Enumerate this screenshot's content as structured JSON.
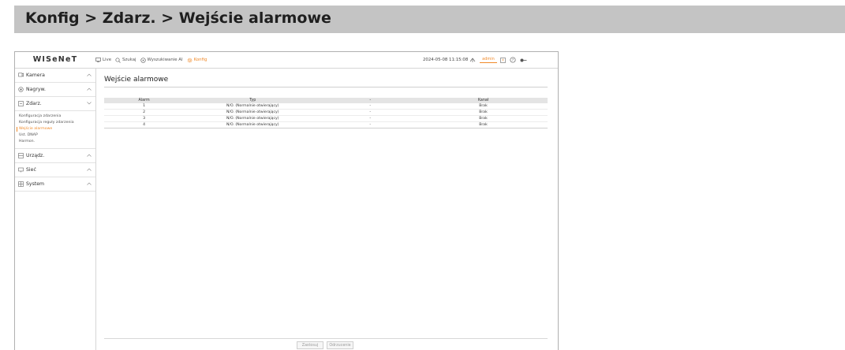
{
  "banner": {
    "title": "Konfig > Zdarz. > Wejście alarmowe"
  },
  "topbar": {
    "logo": "WISeNeT",
    "nav": [
      {
        "label": "Live",
        "icon": "monitor-icon"
      },
      {
        "label": "Szukaj",
        "icon": "search-icon"
      },
      {
        "label": "Wyszukiwanie AI",
        "icon": "ai-search-icon"
      },
      {
        "label": "Konfig",
        "icon": "gear-icon",
        "active": true
      }
    ],
    "datetime": "2024-05-08 11:15:08",
    "user": "admin",
    "icons": [
      "export-icon",
      "notification-icon",
      "help-icon",
      "logout-icon"
    ]
  },
  "sidebar": {
    "sections": [
      {
        "label": "Kamera",
        "icon": "camera-icon",
        "expanded": false
      },
      {
        "label": "Nagryw.",
        "icon": "record-icon",
        "expanded": false
      },
      {
        "label": "Zdarz.",
        "icon": "event-icon",
        "expanded": true
      },
      {
        "label": "Urządz.",
        "icon": "device-icon",
        "expanded": false
      },
      {
        "label": "Sieć",
        "icon": "network-icon",
        "expanded": false
      },
      {
        "label": "System",
        "icon": "system-icon",
        "expanded": false
      }
    ],
    "event_subitems": [
      {
        "label": "Konfiguracja zdarzenia",
        "active": false
      },
      {
        "label": "Konfiguracja reguły zdarzenia",
        "active": false
      },
      {
        "label": "Wejście alarmowe",
        "active": true
      },
      {
        "label": "Ust. DNAP",
        "active": false
      },
      {
        "label": "Harmon.",
        "active": false
      }
    ]
  },
  "content": {
    "title": "Wejście alarmowe",
    "table": {
      "headers": [
        "Alarm",
        "Typ",
        "-",
        "Kanał"
      ],
      "rows": [
        [
          "1",
          "N/O. (Normalnie otwierający)",
          "-",
          "Brak"
        ],
        [
          "2",
          "N/O. (Normalnie otwierający)",
          "-",
          "Brak"
        ],
        [
          "3",
          "N/O. (Normalnie otwierający)",
          "-",
          "Brak"
        ],
        [
          "4",
          "N/O. (Normalnie otwierający)",
          "-",
          "Brak"
        ]
      ]
    },
    "buttons": {
      "apply": "Zastosuj",
      "cancel": "Odrzucenie"
    }
  },
  "colors": {
    "accent": "#f08a2a",
    "banner": "#c4c4c4",
    "header_row": "#e4e4e4"
  }
}
